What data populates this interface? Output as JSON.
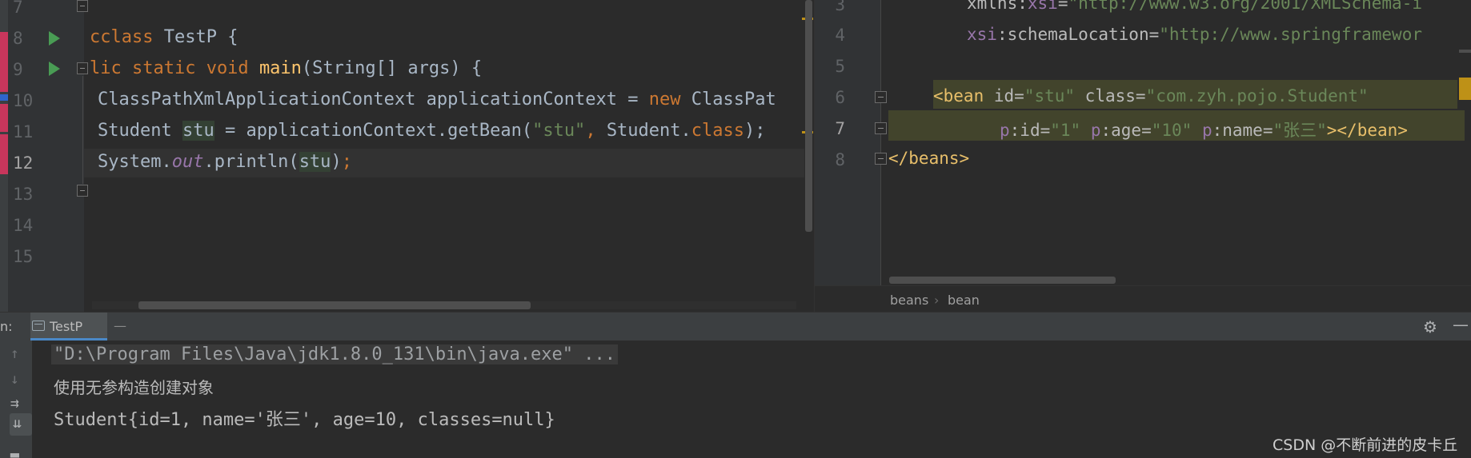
{
  "left_editor": {
    "line_numbers": [
      "7",
      "8",
      "9",
      "10",
      "11",
      "12",
      "13",
      "14",
      "15"
    ],
    "lines": {
      "l8": {
        "kw": "class",
        "name": " TestP {",
        "prefix": "c"
      },
      "l9": {
        "mod": "lic static void",
        "fn": "main",
        "rest": "(String[] args) {"
      },
      "l10": {
        "p1": "ClassPathXmlApplicationContext applicationContext = ",
        "kw": "new",
        "p2": " ClassPat"
      },
      "l11": {
        "p1": "Student ",
        "var": "stu",
        "p2": " = applicationContext.getBean(",
        "str": "\"stu\"",
        "comma": ", ",
        "p3": "Student.",
        "kw": "class",
        "p4": ");"
      },
      "l12": {
        "p1": "System.",
        "field": "out",
        "p2": ".println(",
        "var": "stu",
        "p3": ")",
        "semi": ";"
      }
    }
  },
  "right_editor": {
    "line_numbers": [
      "3",
      "4",
      "5",
      "6",
      "7",
      "8"
    ],
    "lines": {
      "l3": {
        "ns": "xmlns",
        "colon": ":",
        "attr": "xsi",
        "eq": "=",
        "val": "\"http://www.w3.org/2001/XMLSchema-i"
      },
      "l4": {
        "ns": "xsi",
        "colon": ":",
        "attr": "schemaLocation",
        "eq": "=",
        "val": "\"http://www.springframewor"
      },
      "l6": {
        "open": "<bean ",
        "a1": "id",
        "eq1": "=",
        "v1": "\"stu\"",
        "a2": " class",
        "eq2": "=",
        "v2": "\"com.zyh.pojo.Student\""
      },
      "l7": {
        "p1": "p",
        "a1": ":id",
        "eq1": "=",
        "v1": "\"1\"",
        "p2": " p",
        "a2": ":age",
        "eq2": "=",
        "v2": "\"10\"",
        "p3": " p",
        "a3": ":name",
        "eq3": "=",
        "v3": "\"张三\"",
        "close": "></bean>"
      },
      "l8": {
        "close": "</beans>"
      }
    },
    "breadcrumbs": [
      "beans",
      "bean"
    ],
    "breadcrumb_sep": "›"
  },
  "run_panel": {
    "label": "n:",
    "tab_label": "TestP",
    "tab_close": "—",
    "gear": "⚙",
    "minimize": "—",
    "side_icons": [
      "↑",
      "↓",
      "⇉",
      "⇊",
      "▂"
    ],
    "output": [
      "\"D:\\Program Files\\Java\\jdk1.8.0_131\\bin\\java.exe\" ...",
      "使用无参构造创建对象",
      "Student{id=1, name='张三', age=10, classes=null}"
    ],
    "watermark": "CSDN @不断前进的皮卡丘"
  },
  "colors": {
    "keyword": "#cc7832",
    "function": "#ffc66d",
    "string": "#6a8759",
    "xml_tag": "#e8bf6a",
    "run_icon": "#499c54"
  }
}
